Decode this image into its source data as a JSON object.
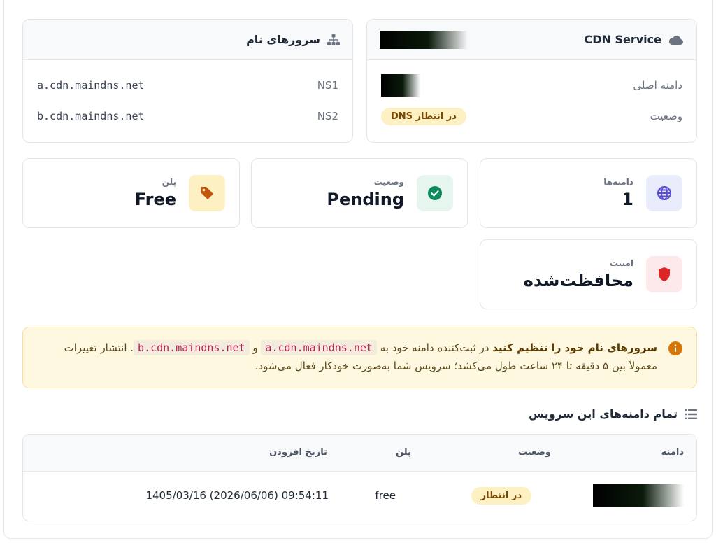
{
  "nameservers": {
    "title": "سرورهای نام",
    "icon": "sitemap-icon",
    "rows": [
      {
        "label": "NS1",
        "value": "a.cdn.maindns.net"
      },
      {
        "label": "NS2",
        "value": "b.cdn.maindns.net"
      }
    ]
  },
  "cdn": {
    "title": "CDN Service",
    "icon": "cloud-icon",
    "primary_domain_label": "دامنه اصلی",
    "status_label": "وضعیت",
    "status_badge": "در انتظار DNS"
  },
  "stats": {
    "domains": {
      "label": "دامنه‌ها",
      "value": "1",
      "icon": "globe-icon",
      "color": "#5b4fd6"
    },
    "status": {
      "label": "وضعیت",
      "value": "Pending",
      "icon": "check-circle-icon",
      "color": "#0f8a5f"
    },
    "plan": {
      "label": "پلن",
      "value": "Free",
      "icon": "tag-icon",
      "color": "#c2560c"
    },
    "security": {
      "label": "امنیت",
      "value": "محافظت‌شده",
      "icon": "shield-icon",
      "color": "#dc2626"
    }
  },
  "alert": {
    "icon": "info-icon",
    "bold": "سرورهای نام خود را تنظیم کنید",
    "text1": "در ثبت‌کننده دامنه خود به",
    "ns1": "a.cdn.maindns.net",
    "and": "و",
    "ns2": "b.cdn.maindns.net",
    "text2": ". انتشار تغییرات معمولاً بین ۵ دقیقه تا ۲۴ ساعت طول می‌کشد؛ سرویس شما به‌صورت خودکار فعال می‌شود."
  },
  "domains_section": {
    "title": "تمام دامنه‌های این سرویس",
    "icon": "list-icon",
    "columns": [
      "دامنه",
      "وضعیت",
      "پلن",
      "تاریخ افزودن"
    ],
    "rows": [
      {
        "status": "در انتظار",
        "plan": "free",
        "date": "1405/03/16 (2026/06/06) 09:54:11"
      }
    ]
  },
  "colors": {
    "accent_warn": "#fdf0c2",
    "alert_bg": "#fff8e1"
  }
}
